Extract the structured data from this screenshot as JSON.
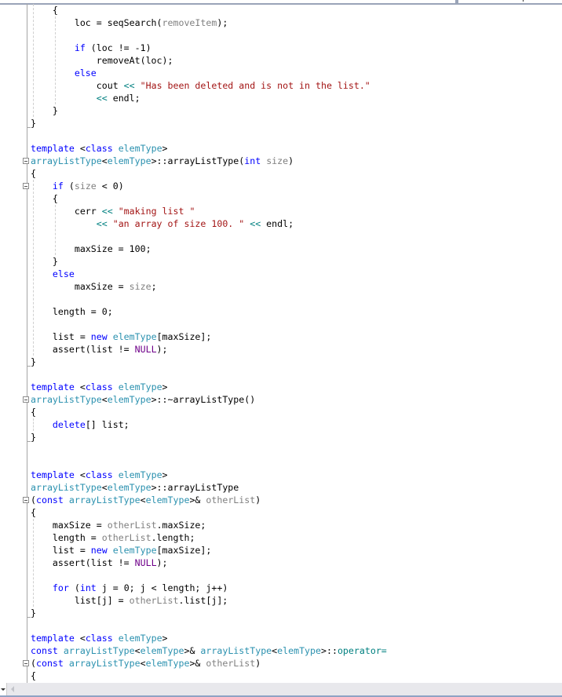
{
  "editor": {
    "language": "cpp",
    "colors": {
      "keyword": "#0000ff",
      "type": "#2b91af",
      "string": "#a31515",
      "operator": "#008080",
      "parameter": "#808080",
      "macro": "#6f008a",
      "text": "#000000"
    },
    "lines": [
      [
        [
          "    {",
          ""
        ]
      ],
      [
        [
          "        loc = seqSearch(",
          ""
        ],
        [
          "removeItem",
          "par"
        ],
        [
          ");",
          ""
        ]
      ],
      [],
      [
        [
          "        ",
          ""
        ],
        [
          "if",
          "kw"
        ],
        [
          " (loc != -1)",
          ""
        ]
      ],
      [
        [
          "            removeAt(loc);",
          ""
        ]
      ],
      [
        [
          "        ",
          ""
        ],
        [
          "else",
          "kw"
        ]
      ],
      [
        [
          "            cout ",
          ""
        ],
        [
          "<<",
          "op"
        ],
        [
          " ",
          ""
        ],
        [
          "\"Has been deleted and is not in the list.\"",
          "str"
        ]
      ],
      [
        [
          "            ",
          ""
        ],
        [
          "<<",
          "op"
        ],
        [
          " endl;",
          ""
        ]
      ],
      [
        [
          "    }",
          ""
        ]
      ],
      [
        [
          "}",
          ""
        ]
      ],
      [],
      [
        [
          "template",
          "kw"
        ],
        [
          " <",
          ""
        ],
        [
          "class",
          "kw"
        ],
        [
          " ",
          ""
        ],
        [
          "elemType",
          "ty"
        ],
        [
          ">",
          ""
        ]
      ],
      [
        [
          "arrayListType",
          "ty"
        ],
        [
          "<",
          ""
        ],
        [
          "elemType",
          "ty"
        ],
        [
          ">::arrayListType(",
          ""
        ],
        [
          "int",
          "kw"
        ],
        [
          " ",
          ""
        ],
        [
          "size",
          "par"
        ],
        [
          ")",
          ""
        ]
      ],
      [
        [
          "{",
          ""
        ]
      ],
      [
        [
          "    ",
          ""
        ],
        [
          "if",
          "kw"
        ],
        [
          " (",
          ""
        ],
        [
          "size",
          "par"
        ],
        [
          " < 0)",
          ""
        ]
      ],
      [
        [
          "    {",
          ""
        ]
      ],
      [
        [
          "        cerr ",
          ""
        ],
        [
          "<<",
          "op"
        ],
        [
          " ",
          ""
        ],
        [
          "\"making list \"",
          "str"
        ]
      ],
      [
        [
          "            ",
          ""
        ],
        [
          "<<",
          "op"
        ],
        [
          " ",
          ""
        ],
        [
          "\"an array of size 100. \"",
          "str"
        ],
        [
          " ",
          ""
        ],
        [
          "<<",
          "op"
        ],
        [
          " endl;",
          ""
        ]
      ],
      [],
      [
        [
          "        maxSize = 100;",
          ""
        ]
      ],
      [
        [
          "    }",
          ""
        ]
      ],
      [
        [
          "    ",
          ""
        ],
        [
          "else",
          "kw"
        ]
      ],
      [
        [
          "        maxSize = ",
          ""
        ],
        [
          "size",
          "par"
        ],
        [
          ";",
          ""
        ]
      ],
      [],
      [
        [
          "    length = 0;",
          ""
        ]
      ],
      [],
      [
        [
          "    list = ",
          ""
        ],
        [
          "new",
          "kw"
        ],
        [
          " ",
          ""
        ],
        [
          "elemType",
          "ty"
        ],
        [
          "[maxSize];",
          ""
        ]
      ],
      [
        [
          "    assert(list != ",
          ""
        ],
        [
          "NULL",
          "mac"
        ],
        [
          ");",
          ""
        ]
      ],
      [
        [
          "}",
          ""
        ]
      ],
      [],
      [
        [
          "template",
          "kw"
        ],
        [
          " <",
          ""
        ],
        [
          "class",
          "kw"
        ],
        [
          " ",
          ""
        ],
        [
          "elemType",
          "ty"
        ],
        [
          ">",
          ""
        ]
      ],
      [
        [
          "arrayListType",
          "ty"
        ],
        [
          "<",
          ""
        ],
        [
          "elemType",
          "ty"
        ],
        [
          ">::~arrayListType()",
          ""
        ]
      ],
      [
        [
          "{",
          ""
        ]
      ],
      [
        [
          "    ",
          ""
        ],
        [
          "delete",
          "kw"
        ],
        [
          "[] list;",
          ""
        ]
      ],
      [
        [
          "}",
          ""
        ]
      ],
      [],
      [],
      [
        [
          "template",
          "kw"
        ],
        [
          " <",
          ""
        ],
        [
          "class",
          "kw"
        ],
        [
          " ",
          ""
        ],
        [
          "elemType",
          "ty"
        ],
        [
          ">",
          ""
        ]
      ],
      [
        [
          "arrayListType",
          "ty"
        ],
        [
          "<",
          ""
        ],
        [
          "elemType",
          "ty"
        ],
        [
          ">::arrayListType",
          ""
        ]
      ],
      [
        [
          "(",
          ""
        ],
        [
          "const",
          "kw"
        ],
        [
          " ",
          ""
        ],
        [
          "arrayListType",
          "ty"
        ],
        [
          "<",
          ""
        ],
        [
          "elemType",
          "ty"
        ],
        [
          ">& ",
          ""
        ],
        [
          "otherList",
          "par"
        ],
        [
          ")",
          ""
        ]
      ],
      [
        [
          "{",
          ""
        ]
      ],
      [
        [
          "    maxSize = ",
          ""
        ],
        [
          "otherList",
          "par"
        ],
        [
          ".maxSize;",
          ""
        ]
      ],
      [
        [
          "    length = ",
          ""
        ],
        [
          "otherList",
          "par"
        ],
        [
          ".length;",
          ""
        ]
      ],
      [
        [
          "    list = ",
          ""
        ],
        [
          "new",
          "kw"
        ],
        [
          " ",
          ""
        ],
        [
          "elemType",
          "ty"
        ],
        [
          "[maxSize];",
          ""
        ]
      ],
      [
        [
          "    assert(list != ",
          ""
        ],
        [
          "NULL",
          "mac"
        ],
        [
          ");",
          ""
        ]
      ],
      [],
      [
        [
          "    ",
          ""
        ],
        [
          "for",
          "kw"
        ],
        [
          " (",
          ""
        ],
        [
          "int",
          "kw"
        ],
        [
          " j = 0; j < length; j++)",
          ""
        ]
      ],
      [
        [
          "        list[j] = ",
          ""
        ],
        [
          "otherList",
          "par"
        ],
        [
          ".list[j];",
          ""
        ]
      ],
      [
        [
          "}",
          ""
        ]
      ],
      [],
      [
        [
          "template",
          "kw"
        ],
        [
          " <",
          ""
        ],
        [
          "class",
          "kw"
        ],
        [
          " ",
          ""
        ],
        [
          "elemType",
          "ty"
        ],
        [
          ">",
          ""
        ]
      ],
      [
        [
          "const",
          "kw"
        ],
        [
          " ",
          ""
        ],
        [
          "arrayListType",
          "ty"
        ],
        [
          "<",
          ""
        ],
        [
          "elemType",
          "ty"
        ],
        [
          ">& ",
          ""
        ],
        [
          "arrayListType",
          "ty"
        ],
        [
          "<",
          ""
        ],
        [
          "elemType",
          "ty"
        ],
        [
          ">::",
          ""
        ],
        [
          "operator=",
          "op"
        ]
      ],
      [
        [
          "(",
          ""
        ],
        [
          "const",
          "kw"
        ],
        [
          " ",
          ""
        ],
        [
          "arrayListType",
          "ty"
        ],
        [
          "<",
          ""
        ],
        [
          "elemType",
          "ty"
        ],
        [
          ">& ",
          ""
        ],
        [
          "otherList",
          "par"
        ],
        [
          ")",
          ""
        ]
      ],
      [
        [
          "{",
          ""
        ]
      ]
    ],
    "fold_markers_at_lines": [
      12,
      14,
      31,
      39,
      52
    ],
    "block_end_lines": [
      9,
      28,
      34,
      48
    ]
  },
  "scrollbar": {
    "dropdown_icon": "chevron-down-icon",
    "left_arrow_icon": "scroll-left-icon"
  }
}
